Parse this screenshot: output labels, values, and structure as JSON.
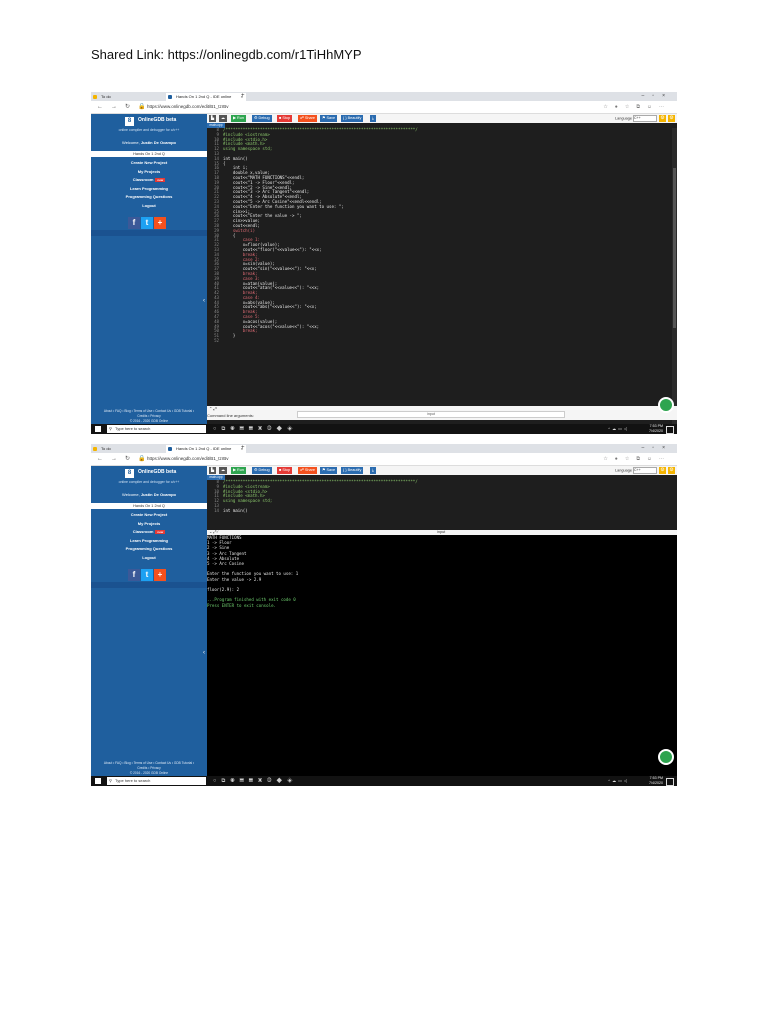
{
  "doc": {
    "title": "Shared Link: https://onlinegdb.com/r1TiHhMYP"
  },
  "browser": {
    "tab1": "To do",
    "tab2": "Hands On 1 2nd Q - IDE online",
    "url": "https://www.onlinegdb.com/edit/B1_tzrBv"
  },
  "sidebar": {
    "logo_letter": "8",
    "logo": "OnlineGDB beta",
    "tagline": "online compiler and debugger for c/c++",
    "welcome_prefix": "Welcome, ",
    "welcome_name": "Justin De Ocampo",
    "selected": "Hands On 1 2nd Q",
    "menu": [
      "Create New Project",
      "My Projects",
      "Classroom",
      "Learn Programming",
      "Programming Questions",
      "Logout"
    ],
    "new_badge": "new",
    "social": [
      "f",
      "t",
      "+"
    ],
    "footer1": "About • FAQ • Blog • Terms of Use • Contact Us • GDB Tutorial •",
    "footer2": "Credits • Privacy",
    "footer3": "© 2016 - 2020 GDB Online"
  },
  "toolbar": {
    "run": "▶ Run",
    "debug": "⚙ Debug",
    "stop": "■ Stop",
    "share": "☍ Share",
    "save": "⚑ Save",
    "beautify": "{ } Beautify",
    "language_label": "Language",
    "language": "C++"
  },
  "filetab": "main.cpp",
  "code1": [
    {
      "n": "8",
      "t": "/*****************************************************************************/"
    },
    {
      "n": "9",
      "t": "#include <iostream>"
    },
    {
      "n": "10",
      "t": "#include <stdio.h>"
    },
    {
      "n": "11",
      "t": "#include <math.h>"
    },
    {
      "n": "12",
      "t": "using namespace std;"
    },
    {
      "n": "13",
      "t": ""
    },
    {
      "n": "14",
      "t": "int main()"
    },
    {
      "n": "15",
      "t": "{"
    },
    {
      "n": "16",
      "t": "    int i;"
    },
    {
      "n": "17",
      "t": "    double x,value;"
    },
    {
      "n": "18",
      "t": "    cout<<\"MATH FUNCTIONS\"<<endl;"
    },
    {
      "n": "19",
      "t": "    cout<<\"1 -> Floor\"<<endl;"
    },
    {
      "n": "20",
      "t": "    cout<<\"2 -> Sine\"<<endl;"
    },
    {
      "n": "21",
      "t": "    cout<<\"3 -> Arc Tangent\"<<endl;"
    },
    {
      "n": "22",
      "t": "    cout<<\"4 -> Absolute\"<<endl;"
    },
    {
      "n": "23",
      "t": "    cout<<\"5 -> Arc Cosine\"<<endl<<endl;"
    },
    {
      "n": "24",
      "t": "    cout<<\"Enter the function you want to use: \";"
    },
    {
      "n": "25",
      "t": "    cin>>i;"
    },
    {
      "n": "26",
      "t": "    cout<<\"Enter the value -> \";"
    },
    {
      "n": "27",
      "t": "    cin>>value;"
    },
    {
      "n": "28",
      "t": "    cout<<endl;"
    },
    {
      "n": "29",
      "t": "    switch(i)"
    },
    {
      "n": "30",
      "t": "    {"
    },
    {
      "n": "31",
      "t": "        case 1:"
    },
    {
      "n": "32",
      "t": "        x=floor(value);"
    },
    {
      "n": "33",
      "t": "        cout<<\"floor(\"<<value<<\"): \"<<x;"
    },
    {
      "n": "34",
      "t": "        break;"
    },
    {
      "n": "35",
      "t": "        case 2:"
    },
    {
      "n": "36",
      "t": "        x=sin(value);"
    },
    {
      "n": "37",
      "t": "        cout<<\"sin(\"<<value<<\"): \"<<x;"
    },
    {
      "n": "38",
      "t": "        break;"
    },
    {
      "n": "39",
      "t": "        case 3:"
    },
    {
      "n": "40",
      "t": "        x=atan(value);"
    },
    {
      "n": "41",
      "t": "        cout<<\"atan(\"<<value<<\"): \"<<x;"
    },
    {
      "n": "42",
      "t": "        break;"
    },
    {
      "n": "43",
      "t": "        case 4:"
    },
    {
      "n": "44",
      "t": "        x=abs(value);"
    },
    {
      "n": "45",
      "t": "        cout<<\"abs(\"<<value<<\"): \"<<x;"
    },
    {
      "n": "46",
      "t": "        break;"
    },
    {
      "n": "47",
      "t": "        case 5:"
    },
    {
      "n": "48",
      "t": "        x=acos(value);"
    },
    {
      "n": "49",
      "t": "        cout<<\"acos(\"<<value<<\"): \"<<x;"
    },
    {
      "n": "50",
      "t": "        break;"
    },
    {
      "n": "51",
      "t": "    }"
    },
    {
      "n": "52",
      "t": ""
    }
  ],
  "code2": [
    {
      "n": "8",
      "t": "/*****************************************************************************/"
    },
    {
      "n": "9",
      "t": "#include <iostream>"
    },
    {
      "n": "10",
      "t": "#include <stdio.h>"
    },
    {
      "n": "11",
      "t": "#include <math.h>"
    },
    {
      "n": "12",
      "t": "using namespace std;"
    },
    {
      "n": "13",
      "t": ""
    },
    {
      "n": "14",
      "t": "int main()"
    }
  ],
  "io": {
    "cmdline": "Command line arguments:",
    "input": "input",
    "input_label": "input"
  },
  "console": [
    "MATH FUNCTIONS",
    "1 -> Floor",
    "2 -> Sine",
    "3 -> Arc Tangent",
    "4 -> Absolute",
    "5 -> Arc Cosine",
    "",
    "Enter the function you want to use: 1",
    "Enter the value -> 2.9",
    "",
    "floor(2.9): 2",
    "",
    "...Program finished with exit code 0",
    "Press ENTER to exit console."
  ],
  "taskbar": {
    "search": "Type here to search",
    "time": "7:53 PM",
    "date": "7/4/2020"
  }
}
